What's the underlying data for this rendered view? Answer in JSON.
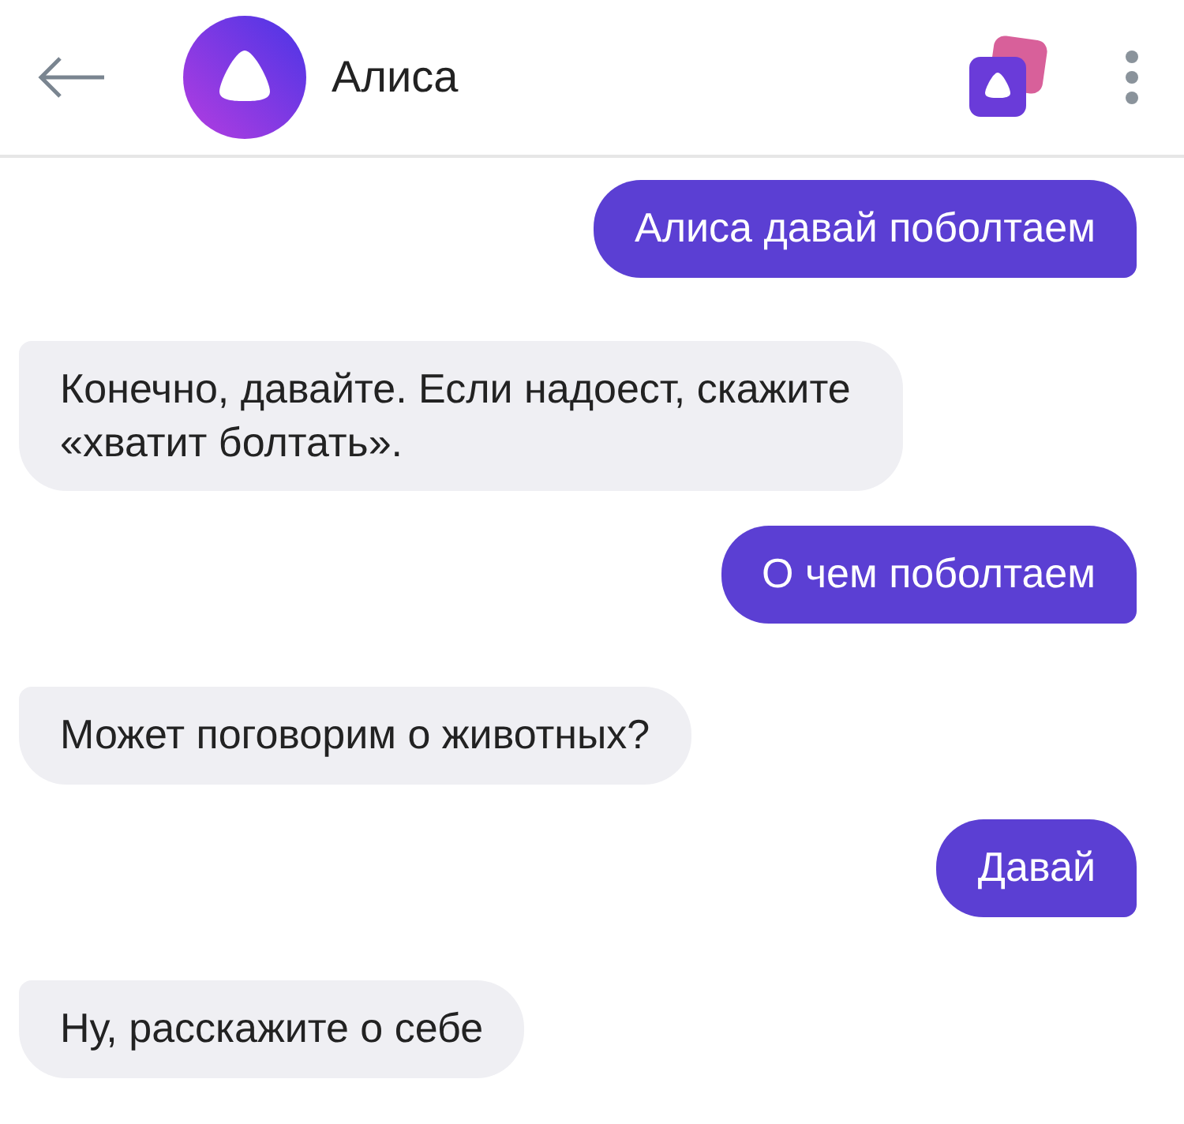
{
  "header": {
    "title": "Алиса"
  },
  "messages": [
    {
      "kind": "user",
      "text": "Алиса давай поболтаем"
    },
    {
      "kind": "bot",
      "text": "Конечно, давайте. Если надоест, скажите «хватит болтать»."
    },
    {
      "kind": "user",
      "text": "О чем поболтаем"
    },
    {
      "kind": "bot",
      "text": "Может поговорим о животных?"
    },
    {
      "kind": "user",
      "text": "Давай"
    },
    {
      "kind": "bot",
      "text": "Ну, расскажите о себе"
    }
  ]
}
